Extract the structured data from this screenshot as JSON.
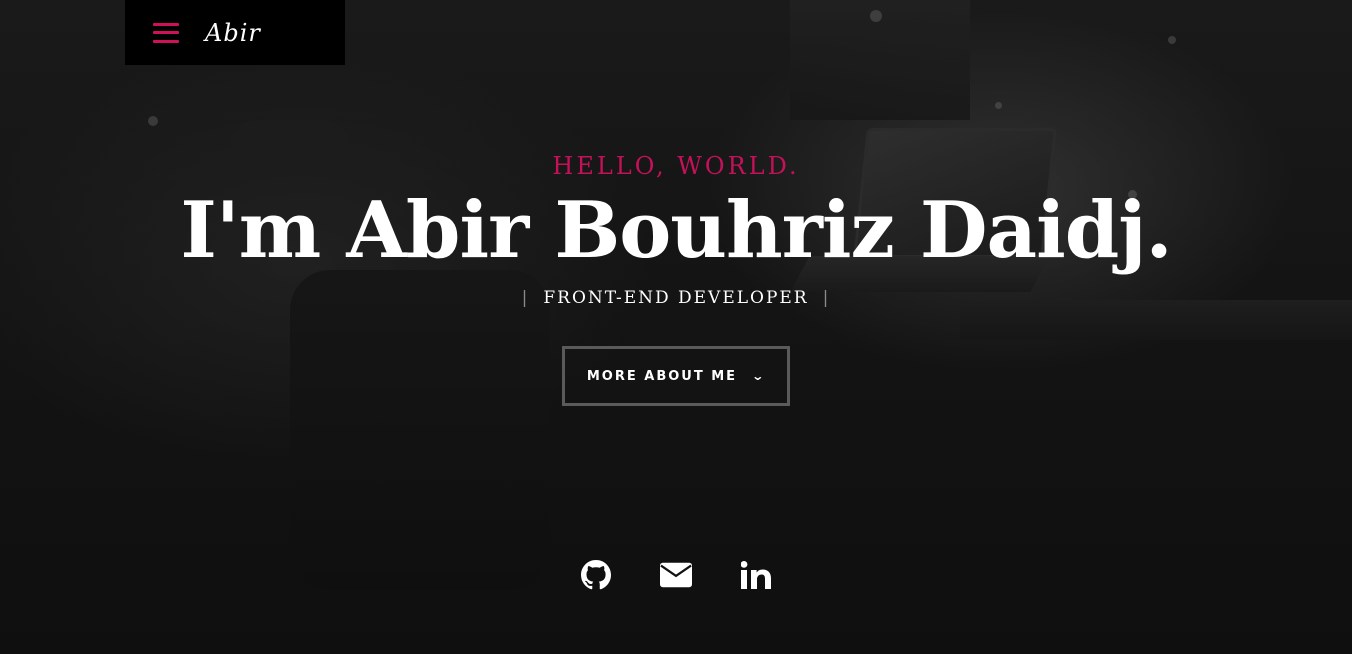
{
  "header": {
    "logo_text": "Abir",
    "menu_icon": "hamburger-icon",
    "menu_color": "#d0105a"
  },
  "hero": {
    "greeting": "HELLO, WORLD.",
    "headline": "I'm Abir Bouhriz Daidj.",
    "role": "FRONT-END DEVELOPER",
    "role_separator": "|",
    "cta_label": "MORE ABOUT ME",
    "cta_icon": "chevron-down-icon",
    "accent_color": "#c5105a"
  },
  "social": {
    "links": [
      {
        "icon": "github-icon"
      },
      {
        "icon": "envelope-icon"
      },
      {
        "icon": "linkedin-icon"
      }
    ]
  }
}
